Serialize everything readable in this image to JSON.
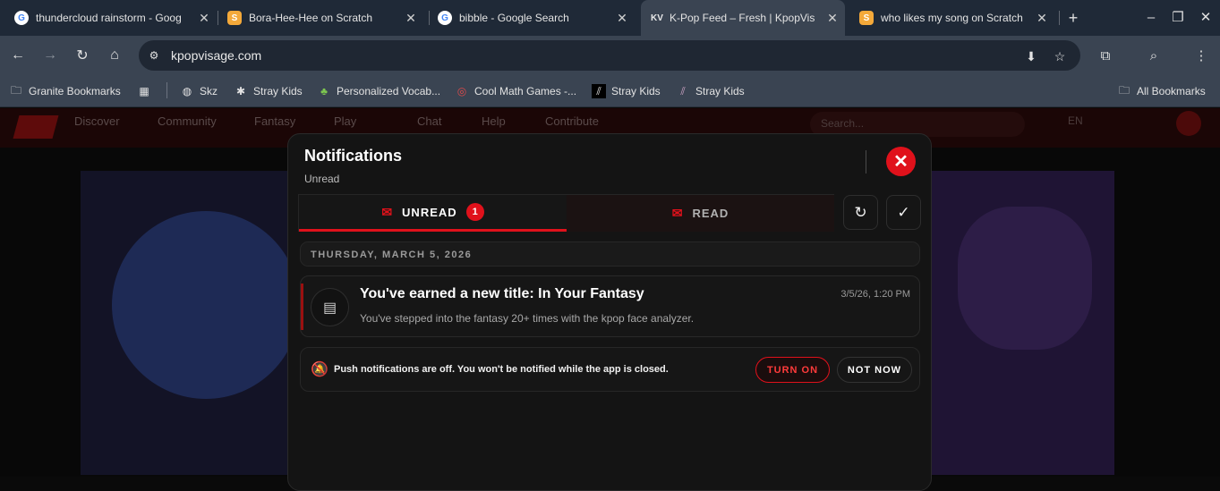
{
  "browser": {
    "tabs": [
      {
        "title": "thundercloud rainstorm - Goog",
        "favicon": "google-icon",
        "active": false
      },
      {
        "title": "Bora-Hee-Hee on Scratch",
        "favicon": "scratch-icon",
        "active": false
      },
      {
        "title": "bibble - Google Search",
        "favicon": "google-icon",
        "active": false
      },
      {
        "title": "K-Pop Feed – Fresh | KpopVis",
        "favicon": "kpopvisage-icon",
        "active": true
      },
      {
        "title": "who likes my song on Scratch",
        "favicon": "scratch-icon",
        "active": false
      }
    ],
    "url": "kpopvisage.com",
    "bookmarks": [
      {
        "label": "Granite Bookmarks",
        "icon": "folder-icon"
      },
      {
        "label": "Skz",
        "icon": "globe-icon"
      },
      {
        "label": "Stray Kids",
        "icon": "bug-icon"
      },
      {
        "label": "Personalized Vocab...",
        "icon": "leaf-icon"
      },
      {
        "label": "Cool Math Games -...",
        "icon": "target-icon"
      },
      {
        "label": "Stray Kids",
        "icon": "skz-logo-icon"
      },
      {
        "label": "Stray Kids",
        "icon": "skz-logo-icon"
      }
    ],
    "all_bookmarks": "All Bookmarks"
  },
  "site_nav": {
    "items": [
      "Discover",
      "Community",
      "Fantasy",
      "Play",
      "Chat",
      "Help",
      "Contribute"
    ],
    "search_placeholder": "Search...",
    "lang": "EN"
  },
  "modal": {
    "title": "Notifications",
    "subtitle": "Unread",
    "tabs": {
      "unread_label": "UNREAD",
      "unread_count": "1",
      "read_label": "READ"
    },
    "date_header": "THURSDAY, MARCH 5, 2026",
    "notification": {
      "title": "You've earned a new title: In Your Fantasy",
      "timestamp": "3/5/26, 1:20 PM",
      "body": "You've stepped into the fantasy 20+ times with the kpop face analyzer."
    },
    "push": {
      "text": "Push notifications are off. You won't be notified while the app is closed.",
      "turn_on": "TURN ON",
      "not_now": "NOT NOW"
    }
  },
  "colors": {
    "accent": "#e0111b",
    "modal_bg": "#141414",
    "tabbar_bg": "#1f2937"
  }
}
